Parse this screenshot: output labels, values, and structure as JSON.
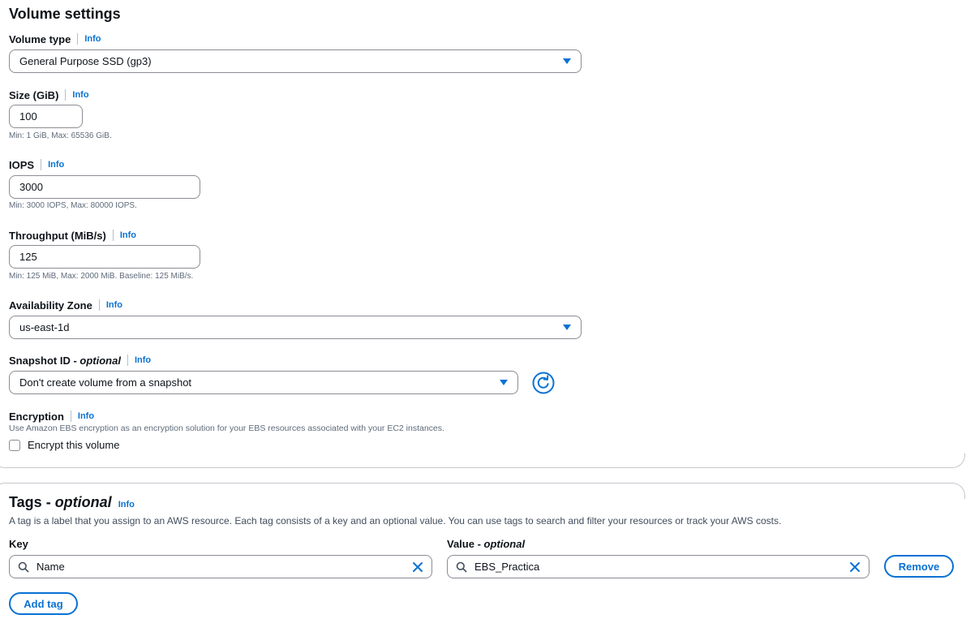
{
  "volume_settings": {
    "title": "Volume settings",
    "info": "Info",
    "volume_type": {
      "label": "Volume type",
      "value": "General Purpose SSD (gp3)"
    },
    "size": {
      "label": "Size (GiB)",
      "value": "100",
      "hint": "Min: 1 GiB, Max: 65536 GiB."
    },
    "iops": {
      "label": "IOPS",
      "value": "3000",
      "hint": "Min: 3000 IOPS, Max: 80000 IOPS."
    },
    "throughput": {
      "label": "Throughput (MiB/s)",
      "value": "125",
      "hint": "Min: 125 MiB, Max: 2000 MiB. Baseline: 125 MiB/s."
    },
    "availability_zone": {
      "label": "Availability Zone",
      "value": "us-east-1d"
    },
    "snapshot": {
      "label": "Snapshot ID",
      "optional": "optional",
      "value": "Don't create volume from a snapshot"
    },
    "encryption": {
      "label": "Encryption",
      "description": "Use Amazon EBS encryption as an encryption solution for your EBS resources associated with your EC2 instances.",
      "checkbox_label": "Encrypt this volume",
      "checked": false
    }
  },
  "tags": {
    "title": "Tags",
    "optional": "optional",
    "info": "Info",
    "description": "A tag is a label that you assign to an AWS resource. Each tag consists of a key and an optional value. You can use tags to search and filter your resources or track your AWS costs.",
    "key_label": "Key",
    "value_label": "Value",
    "value_optional": "optional",
    "rows": [
      {
        "key": "Name",
        "value": "EBS_Practica"
      }
    ],
    "remove_label": "Remove",
    "add_tag_label": "Add tag"
  },
  "colors": {
    "accent": "#0972d3",
    "text": "#0f141a",
    "muted": "#5f6b7a",
    "border": "#8c8c94"
  },
  "icons": [
    "caret-down-icon",
    "refresh-icon",
    "checkbox-icon",
    "search-icon",
    "clear-icon"
  ]
}
